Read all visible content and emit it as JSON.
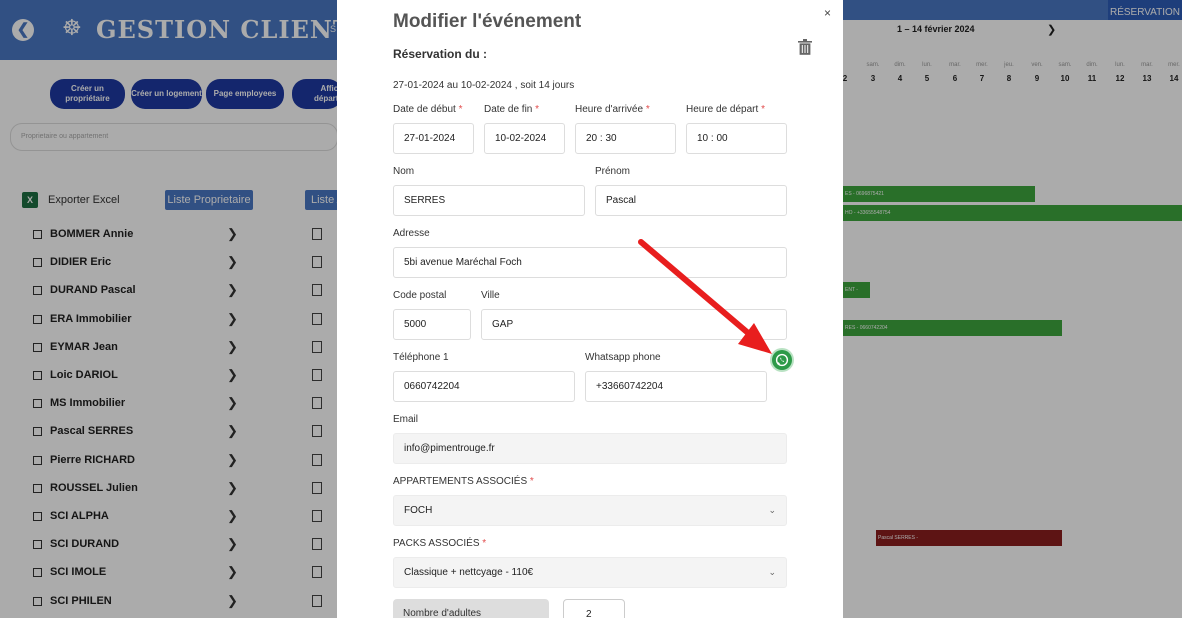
{
  "app": {
    "title": "GESTION CLIENTS",
    "title_cut": "S",
    "back_glyph": "❮",
    "logo_glyph": "☸",
    "reservation_tab": "RÉSERVATION",
    "nav_buttons": [
      {
        "label": "Créer un propriétaire"
      },
      {
        "label": "Créer un logement"
      },
      {
        "label": "Page employees"
      },
      {
        "label": "Affich départs/a"
      }
    ],
    "search_placeholder": "Proprietaire ou appartement",
    "export_excel": "Exporter Excel",
    "excel_glyph": "X",
    "liste_proprietaire": "Liste Proprietaire",
    "liste_cut": "Liste A",
    "owners": [
      {
        "name": "BOMMER Annie"
      },
      {
        "name": "DIDIER Eric"
      },
      {
        "name": "DURAND Pascal"
      },
      {
        "name": "ERA Immobilier"
      },
      {
        "name": "EYMAR Jean"
      },
      {
        "name": "Loic DARIOL"
      },
      {
        "name": "MS Immobilier"
      },
      {
        "name": "Pascal SERRES"
      },
      {
        "name": "Pierre RICHARD"
      },
      {
        "name": "ROUSSEL Julien"
      },
      {
        "name": "SCI ALPHA"
      },
      {
        "name": "SCI DURAND"
      },
      {
        "name": "SCI IMOLE"
      },
      {
        "name": "SCI PHILEN"
      }
    ],
    "chevron_glyph": "❯"
  },
  "calendar": {
    "range": "1 – 14 février 2024",
    "next": "❯",
    "days": [
      {
        "day": "",
        "num": "2"
      },
      {
        "day": "sam.",
        "num": "3"
      },
      {
        "day": "dim.",
        "num": "4"
      },
      {
        "day": "lun.",
        "num": "5"
      },
      {
        "day": "mar.",
        "num": "6"
      },
      {
        "day": "mer.",
        "num": "7"
      },
      {
        "day": "jeu.",
        "num": "8"
      },
      {
        "day": "ven.",
        "num": "9"
      },
      {
        "day": "sam.",
        "num": "10"
      },
      {
        "day": "dim.",
        "num": "11"
      },
      {
        "day": "lun.",
        "num": "12"
      },
      {
        "day": "mar.",
        "num": "13"
      },
      {
        "day": "mer.",
        "num": "14"
      }
    ],
    "bars": [
      {
        "label": "ES - 0696875421",
        "color": "#3ea63e"
      },
      {
        "label": "HO - +33655548754",
        "color": "#3ea63e"
      },
      {
        "label": "ENT -",
        "color": "#3ea63e"
      },
      {
        "label": "RES - 0660742204",
        "color": "#3ea63e"
      },
      {
        "label": "Pascal SERRES -",
        "color": "#8b1f1f"
      }
    ]
  },
  "modal": {
    "title": "Modifier l'événement",
    "close": "×",
    "subheading": "Réservation du :",
    "period": "27-01-2024 au 10-02-2024 , soit 14 jours",
    "required_mark": "*",
    "labels": {
      "start_date": "Date de début",
      "end_date": "Date de fin",
      "arrival_time": "Heure d'arrivée",
      "departure_time": "Heure de départ",
      "last_name": "Nom",
      "first_name": "Prénom",
      "address": "Adresse",
      "postal_code": "Code postal",
      "city": "Ville",
      "phone": "Téléphone 1",
      "whatsapp": "Whatsapp phone",
      "email": "Email",
      "apartments": "APPARTEMENTS ASSOCIÉS",
      "packs": "PACKS ASSOCIÉS"
    },
    "values": {
      "start_date": "27-01-2024",
      "end_date": "10-02-2024",
      "arrival_time": "20 : 30",
      "departure_time": "10 : 00",
      "last_name": "SERRES",
      "first_name": "Pascal",
      "address": "5bi avenue Maréchal Foch",
      "postal_code": "5000",
      "city": "GAP",
      "phone": "0660742204",
      "whatsapp": "+33660742204",
      "email": "info@pimentrouge.fr",
      "apartment": "FOCH",
      "pack": "Classique + nettcyage - 110€"
    },
    "adults_label": "Nombre d'adultes",
    "adults_value": "2",
    "select_chevron": "⌄"
  },
  "colors": {
    "header_blue": "#4a78c4",
    "nav_button_blue": "#1f3aa3",
    "whatsapp_green": "#2d9a48",
    "required_red": "#e24b4b",
    "annotation_red": "#e81e1e"
  }
}
